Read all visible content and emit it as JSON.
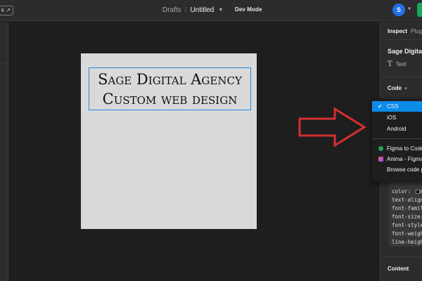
{
  "topbar": {
    "link_fragment": "k ↗",
    "breadcrumb": {
      "drafts": "Drafts",
      "separator": "/",
      "file_title": "Untitled"
    },
    "dev_mode_label": "Dev Mode",
    "avatar_initial": "S"
  },
  "canvas": {
    "text_lines": [
      "Sage Digital Agency",
      "Custom web design"
    ],
    "frame_color": "#d9d9d9",
    "selection_color": "#1e88e5"
  },
  "annotation": {
    "arrow_color": "#d32f2f"
  },
  "inspect_panel": {
    "tabs": [
      "Inspect",
      "Plugins"
    ],
    "layer_name": "Sage Digital Agency",
    "layer_type": "Text",
    "code_section_label": "Code",
    "code_lines": [
      "color:",
      "text-align:",
      "font-family:",
      "font-size:",
      "font-style:",
      "font-weight:",
      "line-height:"
    ],
    "content_label": "Content"
  },
  "code_dropdown": {
    "languages": [
      {
        "label": "CSS",
        "selected": true
      },
      {
        "label": "iOS",
        "selected": false
      },
      {
        "label": "Android",
        "selected": false
      }
    ],
    "plugins": [
      {
        "label": "Figma to Code"
      },
      {
        "label": "Anima - Figma to Code"
      }
    ],
    "browse_label": "Browse code plugins",
    "accent_color": "#0c8ce9"
  }
}
